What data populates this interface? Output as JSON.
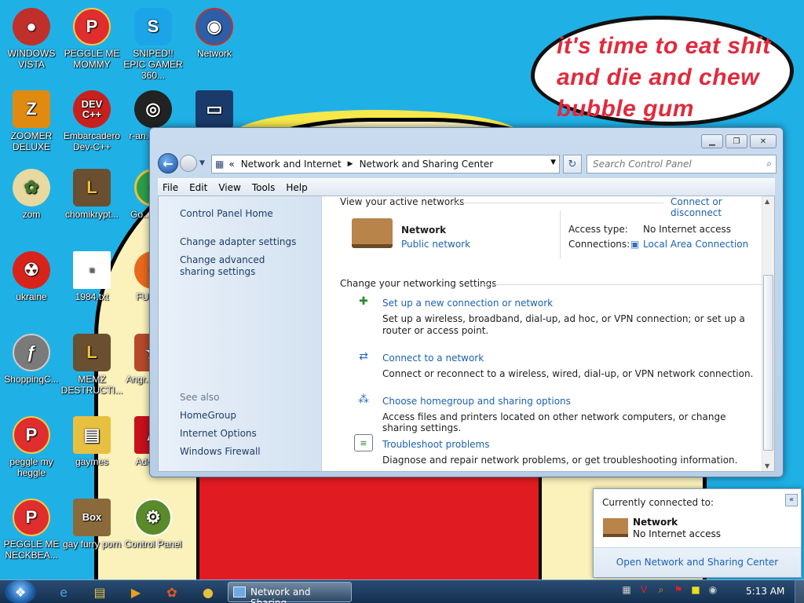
{
  "wallpaper": {
    "speech_lines": [
      "it's time to eat shit",
      "and die and chew",
      "bubble gum"
    ]
  },
  "desktop_icons": [
    {
      "label": "WINDOWS VISTA",
      "icon": "red-car-icon",
      "color": "#c0302a"
    },
    {
      "label": "PEGGLE ME MOMMY",
      "icon": "peggle-icon",
      "color": "#e02d2d"
    },
    {
      "label": "SNIPED!! EPIC GAMER 360...",
      "icon": "skype-icon",
      "color": "#1ca4e8"
    },
    {
      "label": "Network",
      "icon": "network-globe-icon",
      "color": "#2d5fa8"
    },
    {
      "label": "ZOOMER DELUXE",
      "icon": "zoomer-icon",
      "color": "#e08a10"
    },
    {
      "label": "Embarcadero Dev-C++",
      "icon": "devcpp-icon",
      "color": "#c8201d"
    },
    {
      "label": "r-an... par...",
      "icon": "disc-icon",
      "color": "#222"
    },
    {
      "label": "",
      "icon": "monitor-icon",
      "color": "#1a3a6a"
    },
    {
      "label": "zom",
      "icon": "flower-icon",
      "color": "#e8d9a0"
    },
    {
      "label": "chomikrypt...",
      "icon": "hourglass-icon",
      "color": "#6a5030"
    },
    {
      "label": "Go... Chr...",
      "icon": "chrome-icon",
      "color": "#2d9e4a"
    },
    {
      "label": "ukraine",
      "icon": "radiation-icon",
      "color": "#d8231b"
    },
    {
      "label": "1984.txt",
      "icon": "text-file-icon",
      "color": "#ffffff"
    },
    {
      "label": "FURR...",
      "icon": "firefox-icon",
      "color": "#e8691b"
    },
    {
      "label": "ShoppingC...",
      "icon": "flash-icon",
      "color": "#7a7a7a"
    },
    {
      "label": "MEMZ DESTRUCTI...",
      "icon": "hourglass-icon",
      "color": "#6a5030"
    },
    {
      "label": "Angr... Sea...",
      "icon": "game-icon",
      "color": "#b54a2a"
    },
    {
      "label": "peggle my heggle",
      "icon": "peggle-icon",
      "color": "#e02d2d"
    },
    {
      "label": "gaymes",
      "icon": "folder-icon",
      "color": "#e8c040"
    },
    {
      "label": "Adobe...",
      "icon": "adobe-icon",
      "color": "#c8101d"
    },
    {
      "label": "PEGGLE ME NECKBEA...",
      "icon": "peggle-icon",
      "color": "#e02d2d"
    },
    {
      "label": "gay furry porn",
      "icon": "box-icon",
      "color": "#8a6a3a"
    },
    {
      "label": "Control Panel",
      "icon": "control-panel-icon",
      "color": "#5a8a2a"
    }
  ],
  "window": {
    "address": {
      "prefix": "«",
      "crumbs": [
        "Network and Internet",
        "Network and Sharing Center"
      ]
    },
    "search_placeholder": "Search Control Panel",
    "menu": [
      "File",
      "Edit",
      "View",
      "Tools",
      "Help"
    ],
    "left_pane": {
      "home": "Control Panel Home",
      "links": [
        "Change adapter settings",
        "Change advanced sharing settings"
      ],
      "see_also_title": "See also",
      "see_also": [
        "HomeGroup",
        "Internet Options",
        "Windows Firewall"
      ]
    },
    "active_networks": {
      "title": "View your active networks",
      "connect_link": "Connect or disconnect",
      "network_name": "Network",
      "network_type": "Public network",
      "access_type_label": "Access type:",
      "access_type_value": "No Internet access",
      "connections_label": "Connections:",
      "connections_value": "Local Area Connection"
    },
    "settings": {
      "title": "Change your networking settings",
      "items": [
        {
          "link": "Set up a new connection or network",
          "desc": "Set up a wireless, broadband, dial-up, ad hoc, or VPN connection; or set up a router or access point.",
          "icon": "new-connection-icon"
        },
        {
          "link": "Connect to a network",
          "desc": "Connect or reconnect to a wireless, wired, dial-up, or VPN network connection.",
          "icon": "connect-network-icon"
        },
        {
          "link": "Choose homegroup and sharing options",
          "desc": "Access files and printers located on other network computers, or change sharing settings.",
          "icon": "homegroup-icon"
        },
        {
          "link": "Troubleshoot problems",
          "desc": "Diagnose and repair network problems, or get troubleshooting information.",
          "icon": "troubleshoot-icon"
        }
      ]
    }
  },
  "popup": {
    "title": "Currently connected to:",
    "network_name": "Network",
    "status": "No Internet access",
    "footer_link": "Open Network and Sharing Center"
  },
  "taskbar": {
    "task_label": "Network and Sharing...",
    "clock": "5:13 AM"
  }
}
